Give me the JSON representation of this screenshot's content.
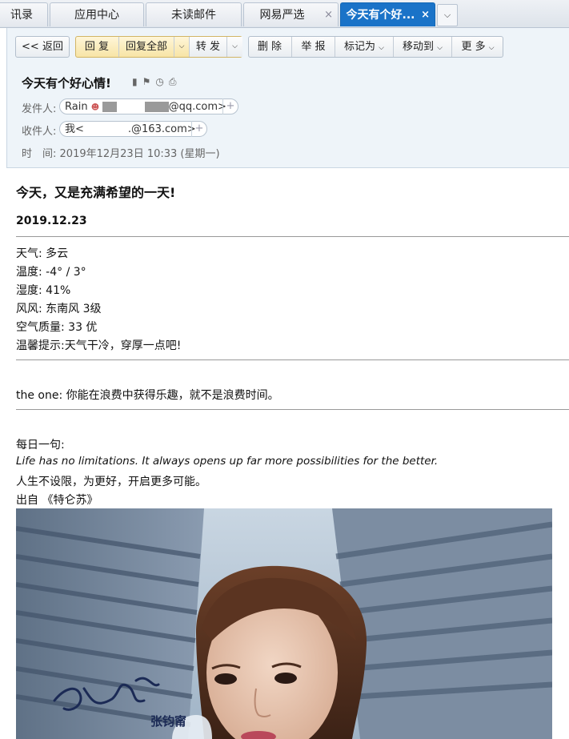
{
  "tabs": [
    {
      "label": "讯录",
      "closable": false,
      "active": false
    },
    {
      "label": "应用中心",
      "closable": false,
      "active": false
    },
    {
      "label": "未读邮件",
      "closable": false,
      "active": false
    },
    {
      "label": "网易严选",
      "closable": true,
      "active": false
    },
    {
      "label": "今天有个好...",
      "closable": true,
      "active": true
    }
  ],
  "tab_close_glyph": "×",
  "tab_menu_glyph": "⌵",
  "toolbar": {
    "back": "<< 返回",
    "reply": "回 复",
    "reply_all": "回复全部",
    "forward": "转 发",
    "delete": "删 除",
    "report": "举 报",
    "mark_as": "标记为",
    "move_to": "移动到",
    "more": "更 多",
    "dropdown_glyph": "⌵"
  },
  "email": {
    "subject": "今天有个好心情!",
    "subject_icons": [
      "bookmark-icon",
      "flag-icon",
      "clock-icon",
      "print-icon"
    ],
    "sender_label": "发件人:",
    "sender_name": "Rain",
    "sender_email_suffix": "@qq.com>",
    "recipient_label": "收件人:",
    "recipient_name": "我<",
    "recipient_email_suffix": ".@163.com>",
    "time_label": "时　间:",
    "time_value": "2019年12月23日 10:33 (星期一)",
    "add_glyph": "+"
  },
  "content": {
    "heading": "今天，又是充满希望的一天!",
    "date": "2019.12.23",
    "weather": "天气: 多云",
    "temperature": "温度: -4° / 3°",
    "humidity": "湿度: 41%",
    "wind": "风风: 东南风 3级",
    "air_quality": "空气质量: 33 优",
    "tip": "温馨提示:天气干冷，穿厚一点吧!",
    "the_one": "the one: 你能在浪费中获得乐趣，就不是浪费时间。",
    "daily_label": "每日一句:",
    "quote_en": "Life has no limitations. It always opens up far more possibilities for the better.",
    "quote_cn": "人生不设限，为更好，开启更多可能。",
    "source": "出自 《特仑苏》",
    "photo_signature": "张钧甯"
  }
}
